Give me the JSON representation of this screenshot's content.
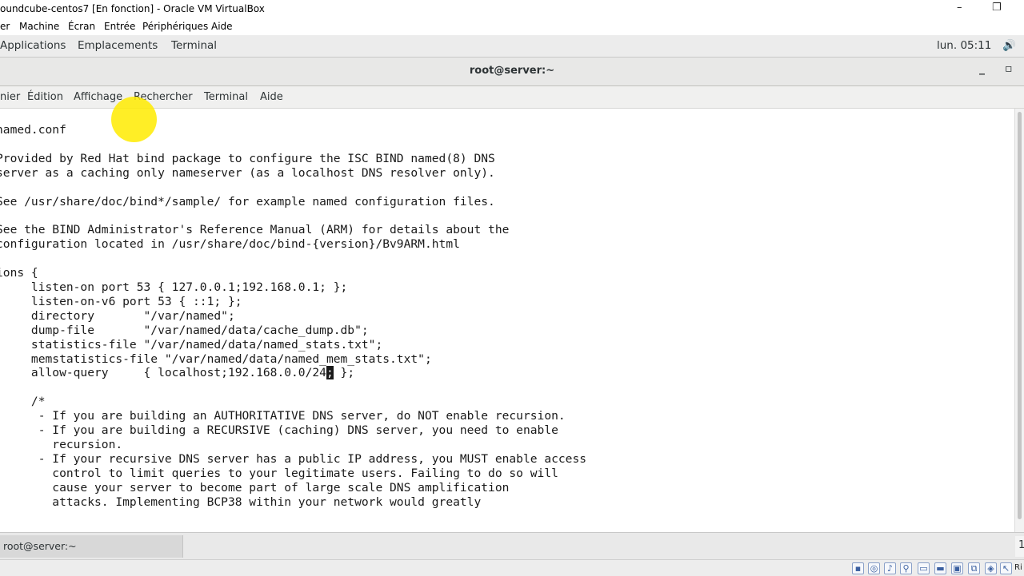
{
  "vbox": {
    "title": "oundcube-centos7 [En fonction] - Oracle VM VirtualBox",
    "minimize": "–",
    "restore": "❐",
    "menu": [
      "er",
      "Machine",
      "Écran",
      "Entrée",
      "Périphériques",
      "Aide"
    ]
  },
  "gnome": {
    "applications": "Applications",
    "places": "Emplacements",
    "terminal": "Terminal",
    "clock": "lun. 05:11",
    "volume_icon": "🔊"
  },
  "terminal": {
    "title": "root@server:~",
    "minimize": "_",
    "maximize": "▫",
    "menu": [
      "nier",
      "Édition",
      "Affichage",
      "Rechercher",
      "Terminal",
      "Aide"
    ],
    "lines": [
      "named.conf",
      "",
      "Provided by Red Hat bind package to configure the ISC BIND named(8) DNS",
      "server as a caching only nameserver (as a localhost DNS resolver only).",
      "",
      "See /usr/share/doc/bind*/sample/ for example named configuration files.",
      "",
      "See the BIND Administrator's Reference Manual (ARM) for details about the",
      "configuration located in /usr/share/doc/bind-{version}/Bv9ARM.html",
      "",
      "ions {",
      "     listen-on port 53 { 127.0.0.1;192.168.0.1; };",
      "     listen-on-v6 port 53 { ::1; };",
      "     directory       \"/var/named\";",
      "     dump-file       \"/var/named/data/cache_dump.db\";",
      "     statistics-file \"/var/named/data/named_stats.txt\";",
      "     memstatistics-file \"/var/named/data/named_mem_stats.txt\";",
      "     allow-query     { localhost;192.168.0.0/24; };",
      "",
      "     /*",
      "      - If you are building an AUTHORITATIVE DNS server, do NOT enable recursion.",
      "      - If you are building a RECURSIVE (caching) DNS server, you need to enable",
      "        recursion.",
      "      - If your recursive DNS server has a public IP address, you MUST enable access",
      "        control to limit queries to your legitimate users. Failing to do so will",
      "        cause your server to become part of large scale DNS amplification",
      "        attacks. Implementing BCP38 within your network would greatly"
    ]
  },
  "taskbar": {
    "task": "root@server:~",
    "page": "1"
  },
  "status": {
    "icons": [
      "hdd-icon",
      "optical-icon",
      "audio-icon",
      "usb-icon",
      "shared-folder-icon",
      "display-icon",
      "recording-icon",
      "network-icon",
      "cpu-icon",
      "mouse-icon"
    ],
    "right_ctrl": "Ri"
  },
  "colors": {
    "highlight": "#ffeb00",
    "cursor_bg": "#1a1a1a"
  }
}
